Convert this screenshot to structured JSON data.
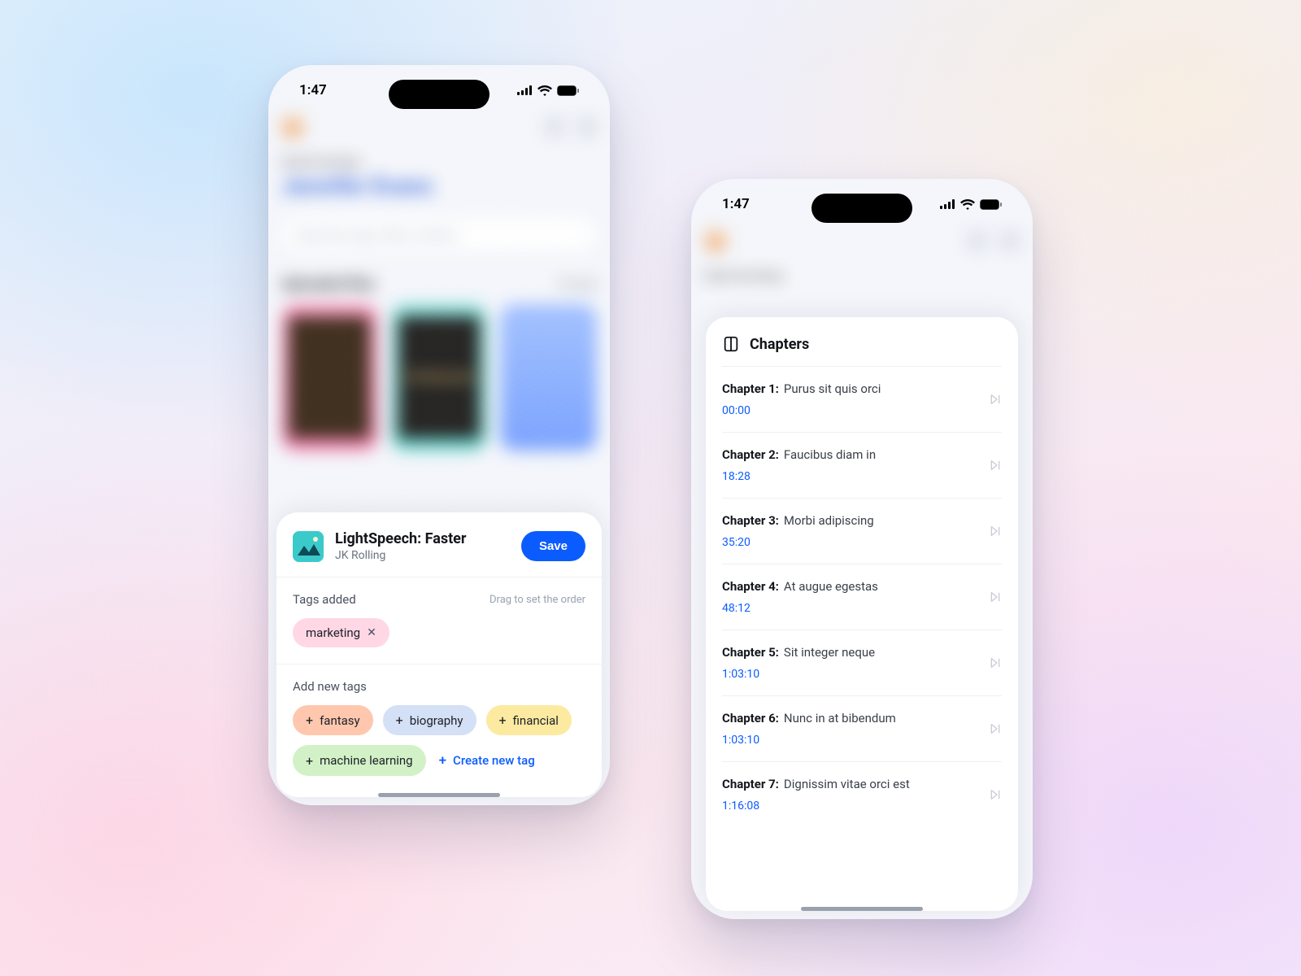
{
  "status": {
    "time": "1:47"
  },
  "phoneLeft": {
    "bg": {
      "greeting": "Good morning",
      "name": "Jennifer Evans",
      "searchPlaceholder": "Search by tags, titles, content…",
      "sectionTitle": "Uploaded files",
      "sectionAction": "All tags"
    },
    "sheet": {
      "title": "LightSpeech: Faster",
      "subtitle": "JK Rolling",
      "saveLabel": "Save",
      "tagsAddedLabel": "Tags added",
      "dragHint": "Drag to set the order",
      "tagsAdded": [
        {
          "label": "marketing",
          "color": "pink"
        }
      ],
      "addNewLabel": "Add new tags",
      "suggestions": [
        {
          "label": "fantasy",
          "color": "orange"
        },
        {
          "label": "biography",
          "color": "blue"
        },
        {
          "label": "financial",
          "color": "yellow"
        },
        {
          "label": "machine learning",
          "color": "green"
        }
      ],
      "createLabel": "Create new tag"
    }
  },
  "phoneRight": {
    "bg": {
      "greeting": "Good morning"
    },
    "chaptersTitle": "Chapters",
    "chapters": [
      {
        "num": "Chapter 1:",
        "name": "Purus sit quis orci",
        "time": "00:00"
      },
      {
        "num": "Chapter 2:",
        "name": "Faucibus diam in",
        "time": "18:28"
      },
      {
        "num": "Chapter 3:",
        "name": "Morbi adipiscing",
        "time": "35:20"
      },
      {
        "num": "Chapter 4:",
        "name": "At augue egestas",
        "time": "48:12"
      },
      {
        "num": "Chapter 5:",
        "name": "Sit integer neque",
        "time": "1:03:10"
      },
      {
        "num": "Chapter 6:",
        "name": "Nunc in at bibendum",
        "time": "1:03:10"
      },
      {
        "num": "Chapter 7:",
        "name": "Dignissim vitae orci est",
        "time": "1:16:08"
      }
    ]
  }
}
